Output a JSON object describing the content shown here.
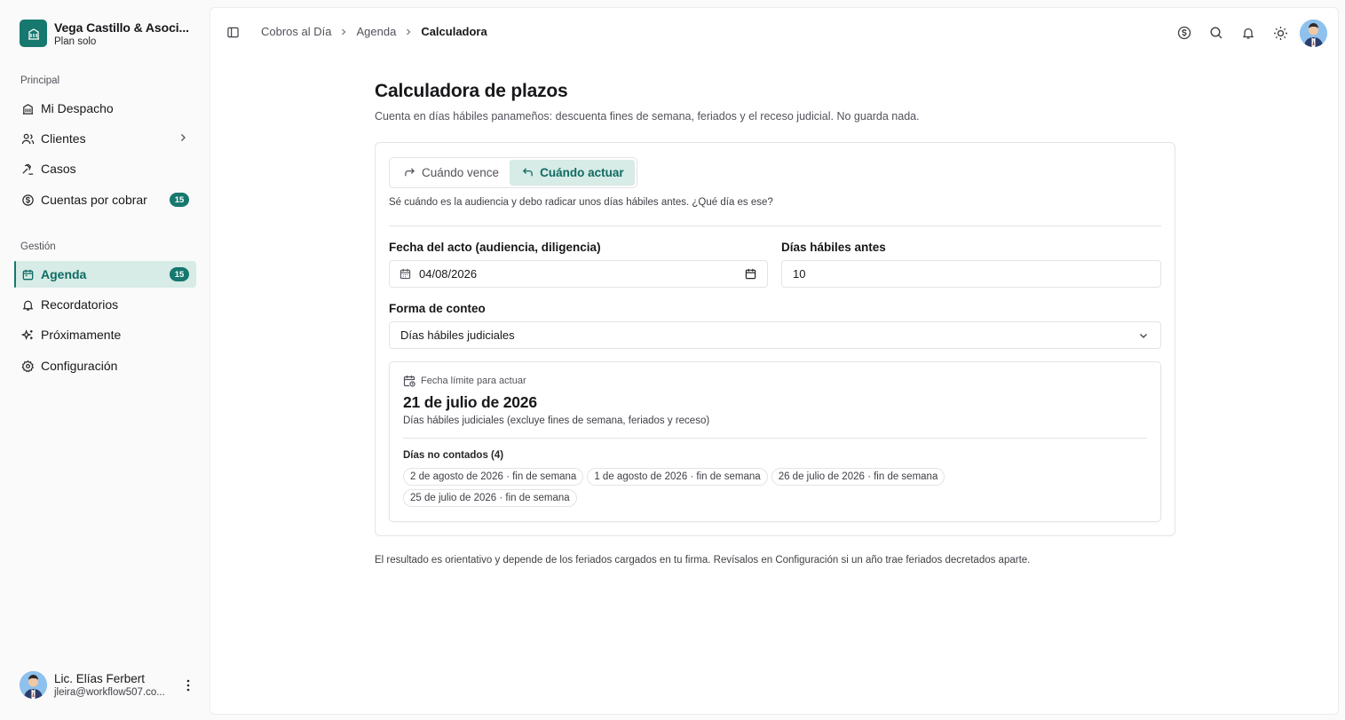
{
  "colors": {
    "accent": "#16786e",
    "accent_soft": "#d7ebe7",
    "accent_text": "#0f6b62"
  },
  "firm": {
    "name": "Vega Castillo & Asoci...",
    "plan": "Plan solo",
    "logo_icon": "building-icon"
  },
  "sidebar": {
    "section_principal": "Principal",
    "section_gestion": "Gestión",
    "principal_items": [
      {
        "label": "Mi Despacho",
        "icon": "building-icon"
      },
      {
        "label": "Clientes",
        "icon": "users-icon"
      },
      {
        "label": "Casos",
        "icon": "gavel-icon"
      },
      {
        "label": "Cuentas por cobrar",
        "icon": "dollar-circle-icon",
        "badge": "15"
      }
    ],
    "gestion_items": [
      {
        "label": "Agenda",
        "icon": "calendar-icon",
        "badge": "15",
        "active": true
      },
      {
        "label": "Recordatorios",
        "icon": "bell-icon"
      },
      {
        "label": "Próximamente",
        "icon": "sparkles-icon"
      },
      {
        "label": "Configuración",
        "icon": "gear-icon"
      }
    ]
  },
  "user": {
    "name": "Lic. Elías Ferbert",
    "email": "jleira@workflow507.co..."
  },
  "breadcrumb": {
    "items": [
      "Cobros al Día",
      "Agenda"
    ],
    "current": "Calculadora"
  },
  "page": {
    "title": "Calculadora de plazos",
    "subtitle": "Cuenta en días hábiles panameños: descuenta fines de semana, feriados y el receso judicial. No guarda nada."
  },
  "calculator": {
    "tabs": [
      {
        "label": "Cuándo vence",
        "icon": "arrow-forward-icon"
      },
      {
        "label": "Cuándo actuar",
        "icon": "arrow-back-icon",
        "active": true
      }
    ],
    "mode_description": "Sé cuándo es la audiencia y debo radicar unos días hábiles antes. ¿Qué día es ese?",
    "date_label": "Fecha del acto (audiencia, diligencia)",
    "date_value": "04/08/2026",
    "days_label": "Días hábiles antes",
    "days_value": "10",
    "count_label": "Forma de conteo",
    "count_value": "Días hábiles judiciales",
    "result": {
      "label": "Fecha límite para actuar",
      "date": "21 de julio de 2026",
      "note": "Días hábiles judiciales (excluye fines de semana, feriados y receso)",
      "excluded_title": "Días no contados (4)",
      "excluded": [
        "2 de agosto de 2026 · fin de semana",
        "1 de agosto de 2026 · fin de semana",
        "26 de julio de 2026 · fin de semana",
        "25 de julio de 2026 · fin de semana"
      ]
    }
  },
  "footnote": "El resultado es orientativo y depende de los feriados cargados en tu firma. Revísalos en Configuración si un año trae feriados decretados aparte."
}
